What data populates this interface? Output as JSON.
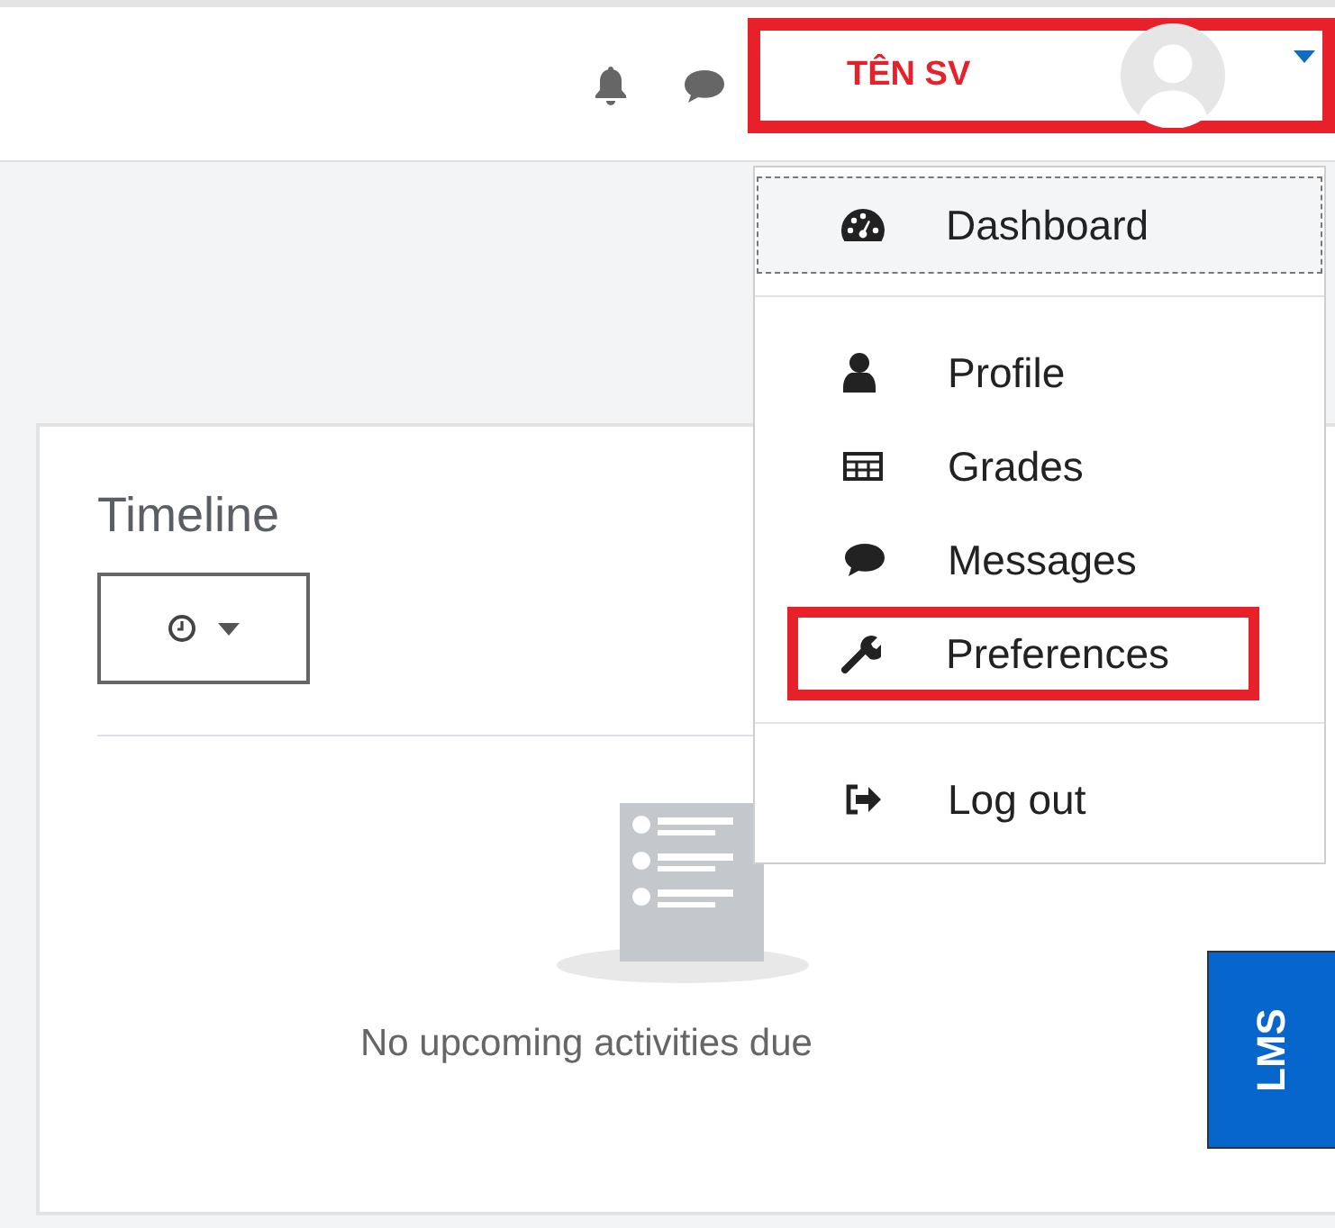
{
  "header": {
    "user_name": "TÊN SV",
    "user_highlighted": true
  },
  "user_menu": {
    "groups": [
      {
        "items": [
          {
            "label": "Dashboard",
            "kind": "dashboard",
            "selected": true,
            "highlighted": false
          }
        ]
      },
      {
        "items": [
          {
            "label": "Profile",
            "kind": "user",
            "selected": false,
            "highlighted": false
          },
          {
            "label": "Grades",
            "kind": "table",
            "selected": false,
            "highlighted": false
          },
          {
            "label": "Messages",
            "kind": "chat",
            "selected": false,
            "highlighted": false
          },
          {
            "label": "Preferences",
            "kind": "wrench",
            "selected": false,
            "highlighted": true
          }
        ]
      },
      {
        "items": [
          {
            "label": "Log out",
            "kind": "logout",
            "selected": false,
            "highlighted": false
          }
        ]
      }
    ]
  },
  "timeline": {
    "title": "Timeline",
    "empty_message": "No upcoming activities due"
  },
  "side_tab": {
    "label": "LMS"
  }
}
